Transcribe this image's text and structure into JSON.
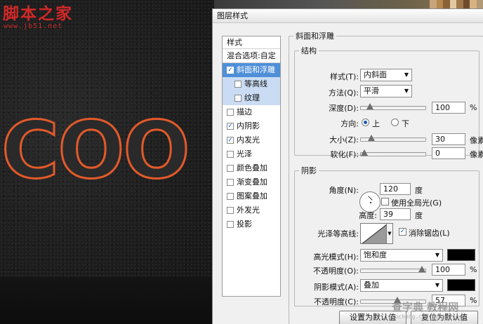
{
  "canvas": {
    "logo_text": "脚本之家",
    "logo_url": "www.jb51.net",
    "big_text": "COO"
  },
  "dialog": {
    "title": "图层样式",
    "styles_list": {
      "header": "样式",
      "blend_options": "混合选项:自定",
      "items": [
        {
          "label": "斜面和浮雕",
          "checked": true,
          "selected": true,
          "sub": false
        },
        {
          "label": "等高线",
          "checked": false,
          "selected": false,
          "sub": true
        },
        {
          "label": "纹理",
          "checked": false,
          "selected": false,
          "sub": true
        },
        {
          "label": "描边",
          "checked": false,
          "selected": false,
          "sub": false
        },
        {
          "label": "内阴影",
          "checked": true,
          "selected": false,
          "sub": false
        },
        {
          "label": "内发光",
          "checked": true,
          "selected": false,
          "sub": false
        },
        {
          "label": "光泽",
          "checked": false,
          "selected": false,
          "sub": false
        },
        {
          "label": "颜色叠加",
          "checked": false,
          "selected": false,
          "sub": false
        },
        {
          "label": "渐变叠加",
          "checked": false,
          "selected": false,
          "sub": false
        },
        {
          "label": "图案叠加",
          "checked": false,
          "selected": false,
          "sub": false
        },
        {
          "label": "外发光",
          "checked": false,
          "selected": false,
          "sub": false
        },
        {
          "label": "投影",
          "checked": false,
          "selected": false,
          "sub": false
        }
      ]
    },
    "bevel": {
      "title": "斜面和浮雕",
      "structure": {
        "title": "结构",
        "style_label": "样式(T):",
        "style_value": "内斜面",
        "technique_label": "方法(Q):",
        "technique_value": "平滑",
        "depth_label": "深度(D):",
        "depth_value": "100",
        "depth_unit": "%",
        "depth_level": 0.1,
        "direction_label": "方向:",
        "direction_up": "上",
        "direction_down": "下",
        "size_label": "大小(Z):",
        "size_value": "30",
        "size_unit": "像素",
        "size_level": 0.12,
        "soften_label": "软化(F):",
        "soften_value": "0",
        "soften_unit": "像素",
        "soften_level": 0.0
      },
      "shading": {
        "title": "阴影",
        "angle_label": "角度(N):",
        "angle_value": "120",
        "angle_unit": "度",
        "global_light_label": "使用全局光(G)",
        "global_light_checked": false,
        "altitude_label": "高度:",
        "altitude_value": "39",
        "altitude_unit": "度",
        "gloss_contour_label": "光泽等高线:",
        "anti_alias_label": "消除锯齿(L)",
        "anti_alias_checked": true,
        "highlight_mode_label": "高光模式(H):",
        "highlight_mode_value": "饱和度",
        "highlight_color": "#000000",
        "highlight_opacity_label": "不透明度(O):",
        "highlight_opacity_value": "100",
        "highlight_opacity_unit": "%",
        "highlight_opacity_level": 1.0,
        "shadow_mode_label": "阴影模式(A):",
        "shadow_mode_value": "叠加",
        "shadow_color": "#000000",
        "shadow_opacity_label": "不透明度(C):",
        "shadow_opacity_value": "57",
        "shadow_opacity_unit": "%",
        "shadow_opacity_level": 0.57
      },
      "default_button": "设置为默认值",
      "reset_button": "复位为默认值"
    }
  },
  "watermark": {
    "text": "查字典 教程网",
    "url": "jiaocheng.chazidian.com"
  },
  "colors": {
    "selection": "#4f8fd8",
    "text_glow": "#e35a2a",
    "logo": "#d32828"
  }
}
